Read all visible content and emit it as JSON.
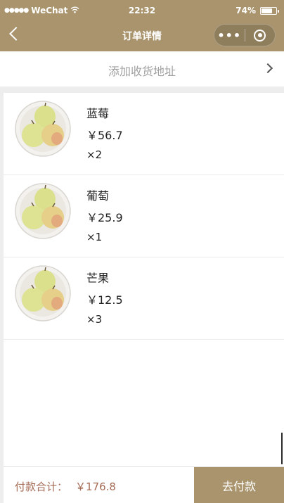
{
  "status_bar": {
    "carrier": "WeChat",
    "signal_icon": "signal-dots-icon",
    "wifi_icon": "wifi-icon",
    "time": "22:32",
    "battery": "74%",
    "battery_level": 0.74
  },
  "nav": {
    "title": "订单详情",
    "back_icon": "chevron-left-icon",
    "more_icon": "more-dots-icon",
    "close_icon": "target-circle-icon",
    "color": "#a9946d"
  },
  "address": {
    "label": "添加收货地址",
    "chevron_icon": "chevron-right-icon"
  },
  "items": [
    {
      "name": "蓝莓",
      "price": "￥56.7",
      "qty": "×2",
      "image_icon": "pears-plate-image"
    },
    {
      "name": "葡萄",
      "price": "￥25.9",
      "qty": "×1",
      "image_icon": "pears-plate-image"
    },
    {
      "name": "芒果",
      "price": "￥12.5",
      "qty": "×3",
      "image_icon": "pears-plate-image"
    }
  ],
  "footer": {
    "total_label": "付款合计：",
    "total_value": "￥176.8",
    "pay_label": "去付款",
    "accent": "#a56a55"
  }
}
